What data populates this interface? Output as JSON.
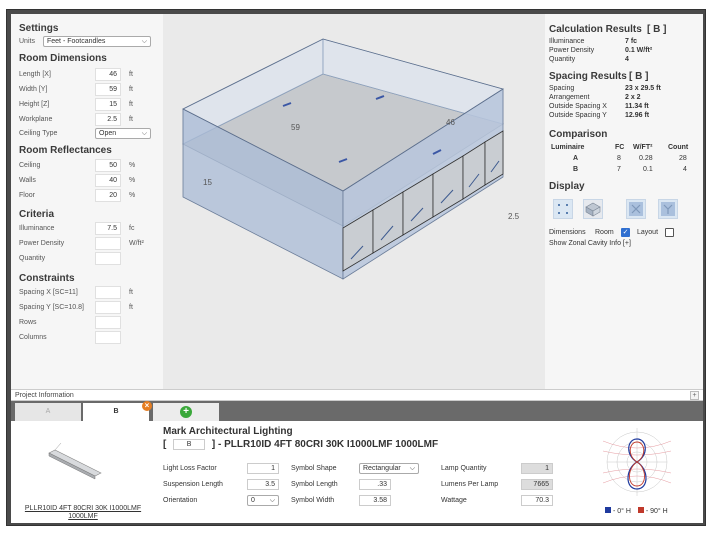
{
  "settings": {
    "title": "Settings",
    "units_label": "Units",
    "units_value": "Feet - Footcandles"
  },
  "room_dimensions": {
    "title": "Room Dimensions",
    "length_label": "Length [X]",
    "length": "46",
    "length_unit": "ft",
    "width_label": "Width [Y]",
    "width": "59",
    "width_unit": "ft",
    "height_label": "Height [Z]",
    "height": "15",
    "height_unit": "ft",
    "workplane_label": "Workplane",
    "workplane": "2.5",
    "workplane_unit": "ft",
    "ceiling_type_label": "Ceiling Type",
    "ceiling_type": "Open"
  },
  "reflectances": {
    "title": "Room Reflectances",
    "ceiling_label": "Ceiling",
    "ceiling": "50",
    "ceiling_unit": "%",
    "walls_label": "Walls",
    "walls": "40",
    "walls_unit": "%",
    "floor_label": "Floor",
    "floor": "20",
    "floor_unit": "%"
  },
  "criteria": {
    "title": "Criteria",
    "illuminance_label": "Illuminance",
    "illuminance": "7.5",
    "illuminance_unit": "fc",
    "power_density_label": "Power Density",
    "power_density": "",
    "power_density_unit": "W/ft²",
    "quantity_label": "Quantity",
    "quantity": ""
  },
  "constraints": {
    "title": "Constraints",
    "spacing_x_label": "Spacing X  [SC=11]",
    "spacing_x": "",
    "spacing_x_unit": "ft",
    "spacing_y_label": "Spacing Y  [SC=10.8]",
    "spacing_y": "",
    "spacing_y_unit": "ft",
    "rows_label": "Rows",
    "rows": "",
    "columns_label": "Columns",
    "columns": ""
  },
  "viewport": {
    "dim_width": "59",
    "dim_length": "46",
    "dim_height": "15",
    "dim_workplane": "2.5"
  },
  "calc_results": {
    "title": "Calculation Results",
    "tag": "[ B ]",
    "rows": [
      {
        "label": "Illuminance",
        "value": "7  fc"
      },
      {
        "label": "Power Density",
        "value": "0.1  W/ft²"
      },
      {
        "label": "Quantity",
        "value": "4"
      }
    ]
  },
  "spacing_results": {
    "title": "Spacing Results",
    "tag": "[ B ]",
    "rows": [
      {
        "label": "Spacing",
        "value": "23 x 29.5  ft"
      },
      {
        "label": "Arrangement",
        "value": "2 x 2"
      },
      {
        "label": "Outside Spacing X",
        "value": "11.34  ft"
      },
      {
        "label": "Outside Spacing Y",
        "value": "12.96  ft"
      }
    ]
  },
  "comparison": {
    "title": "Comparison",
    "headers": [
      "Luminaire",
      "FC",
      "W/FT²",
      "Count"
    ],
    "rows": [
      [
        "A",
        "8",
        "0.28",
        "28"
      ],
      [
        "B",
        "7",
        "0.1",
        "4"
      ]
    ]
  },
  "display": {
    "title": "Display",
    "dimensions_label": "Dimensions",
    "room_label": "Room",
    "room_checked": true,
    "layout_label": "Layout",
    "layout_checked": false,
    "zonal_label": "Show Zonal Cavity Info [+]",
    "icons": [
      "grid-view-icon",
      "iso-view-icon",
      "front-view-icon",
      "side-view-icon"
    ]
  },
  "project_info": {
    "label": "Project Information",
    "expand": "+"
  },
  "tabs": [
    {
      "label": "A"
    },
    {
      "label": "B",
      "close": "×"
    },
    {
      "label": "+"
    }
  ],
  "luminaire": {
    "manufacturer": "Mark Architectural Lighting",
    "open_bracket": "[",
    "tag": "B",
    "product": "] - PLLR10ID 4FT 80CRI 30K I1000LMF 1000LMF",
    "image_caption": "PLLR10ID 4FT 80CRI 30K I1000LMF 1000LMF",
    "llf_label": "Light Loss Factor",
    "llf": "1",
    "suspension_label": "Suspension Length",
    "suspension": "3.5",
    "orientation_label": "Orientation",
    "orientation": "0",
    "symbol_shape_label": "Symbol Shape",
    "symbol_shape": "Rectangular",
    "symbol_length_label": "Symbol Length",
    "symbol_length": ".33",
    "symbol_width_label": "Symbol Width",
    "symbol_width": "3.58",
    "lamp_qty_label": "Lamp Quantity",
    "lamp_qty": "1",
    "lumens_label": "Lumens Per Lamp",
    "lumens": "7665",
    "wattage_label": "Wattage",
    "wattage": "70.3"
  },
  "polar_legend": {
    "h0": "- 0° H",
    "h90": "- 90° H",
    "color_h0": "#1f3a9e",
    "color_h90": "#c0392b"
  },
  "colors": {
    "tab_green": "#3aa83a",
    "tab_close": "#e67e22",
    "room_wall": "#b7c6dc",
    "checkbox": "#2f6fd0"
  }
}
